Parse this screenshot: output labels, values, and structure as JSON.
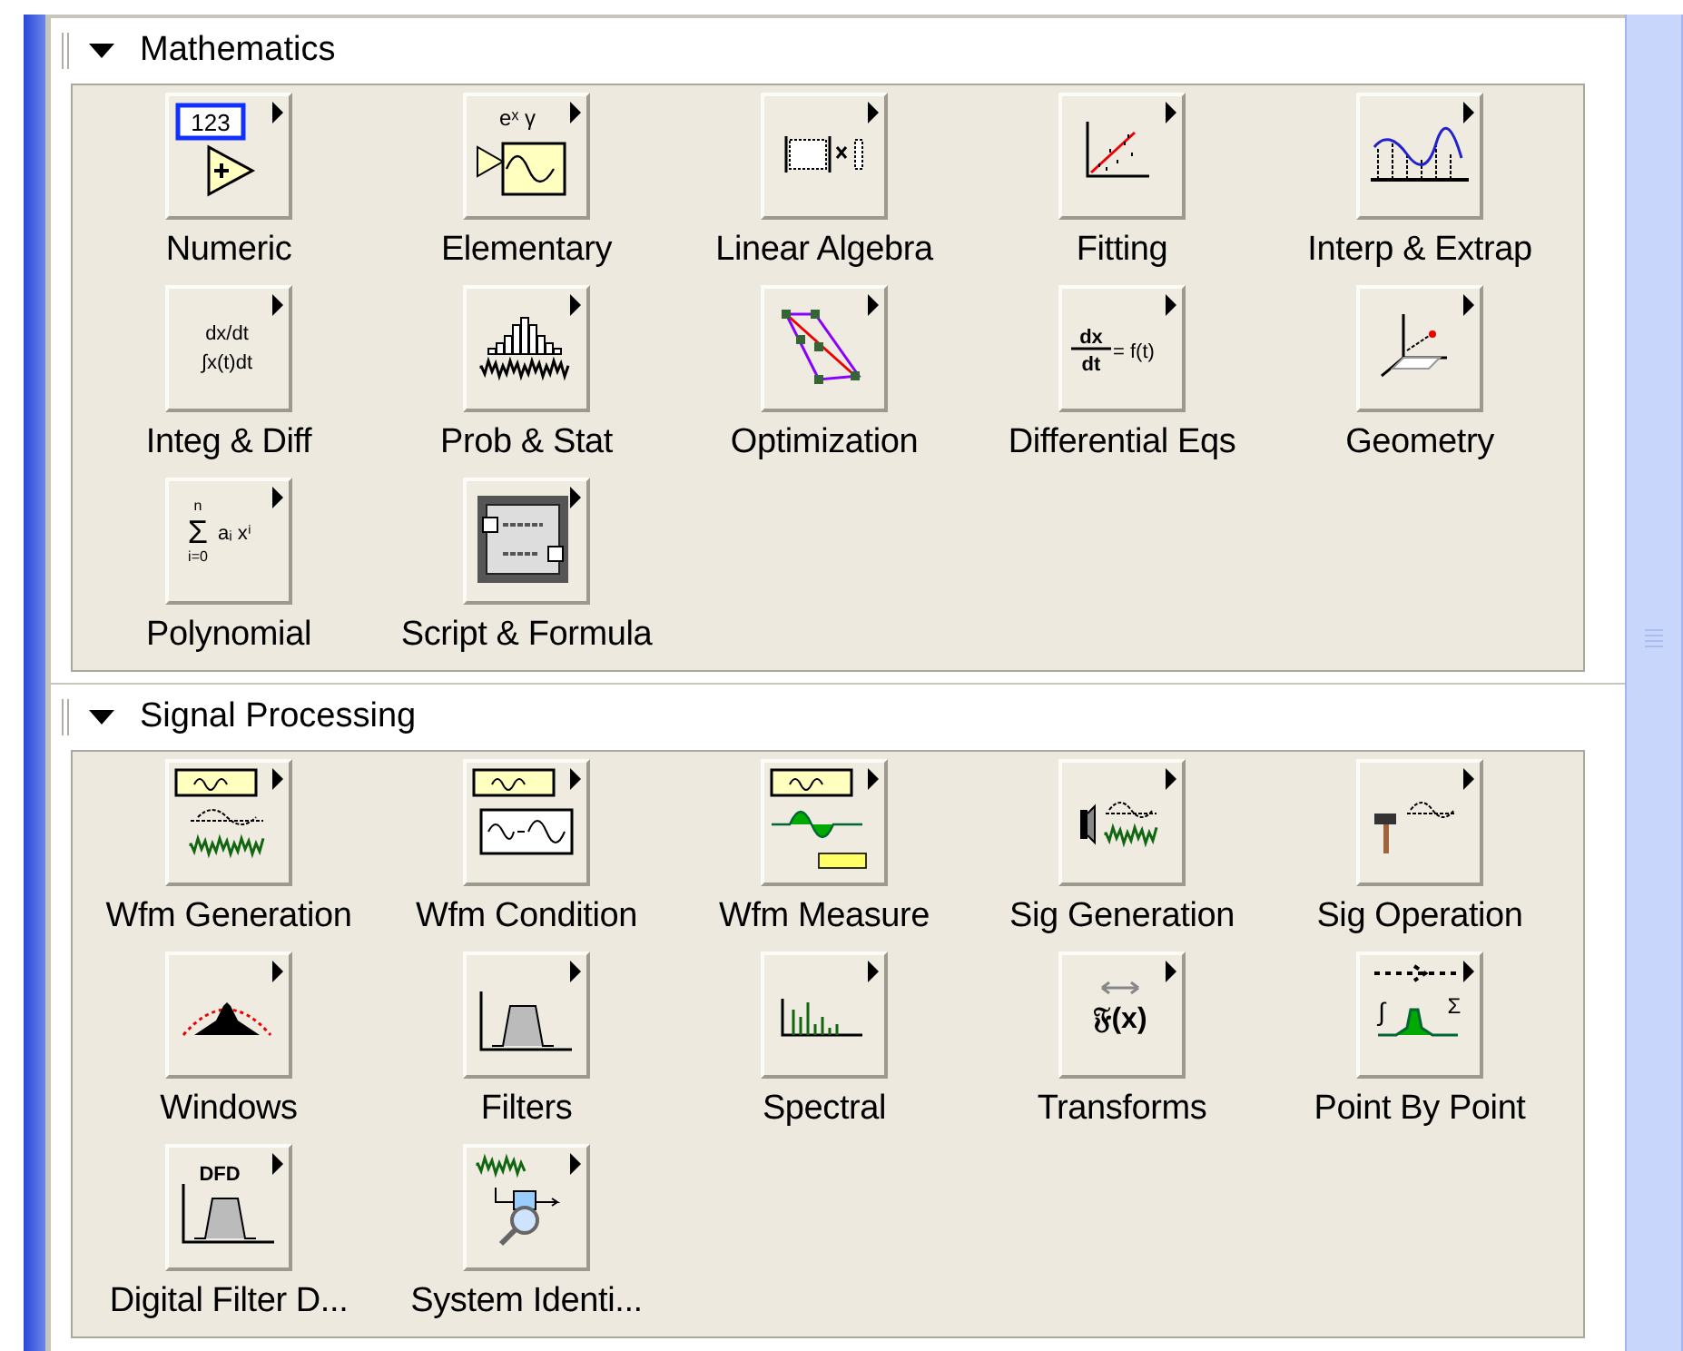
{
  "sections": [
    {
      "title": "Mathematics",
      "expanded": true,
      "items": [
        {
          "label": "Numeric",
          "kind": "numeric",
          "icon_text": [
            "123"
          ]
        },
        {
          "label": "Elementary",
          "kind": "elementary",
          "icon_text": [
            "eˣ γ"
          ]
        },
        {
          "label": "Linear Algebra",
          "kind": "matrix"
        },
        {
          "label": "Fitting",
          "kind": "fit"
        },
        {
          "label": "Interp & Extrap",
          "kind": "interp"
        },
        {
          "label": "Integ & Diff",
          "kind": "integ",
          "icon_text": [
            "dx/dt",
            "∫x(t)dt"
          ]
        },
        {
          "label": "Prob & Stat",
          "kind": "histogram"
        },
        {
          "label": "Optimization",
          "kind": "optimize"
        },
        {
          "label": "Differential Eqs",
          "kind": "diffeq",
          "icon_text": [
            "dx",
            "dt",
            "= f(t)"
          ]
        },
        {
          "label": "Geometry",
          "kind": "axes3d"
        },
        {
          "label": "Polynomial",
          "kind": "poly",
          "icon_text": [
            "n",
            "Σ",
            "i=0",
            "aᵢ xⁱ"
          ]
        },
        {
          "label": "Script & Formula",
          "kind": "script"
        }
      ]
    },
    {
      "title": "Signal Processing",
      "expanded": true,
      "items": [
        {
          "label": "Wfm Generation",
          "kind": "wfm_gen"
        },
        {
          "label": "Wfm Condition",
          "kind": "wfm_cond"
        },
        {
          "label": "Wfm Measure",
          "kind": "wfm_meas"
        },
        {
          "label": "Sig Generation",
          "kind": "sig_gen"
        },
        {
          "label": "Sig Operation",
          "kind": "sig_op"
        },
        {
          "label": "Windows",
          "kind": "window"
        },
        {
          "label": "Filters",
          "kind": "filter"
        },
        {
          "label": "Spectral",
          "kind": "spectral"
        },
        {
          "label": "Transforms",
          "kind": "transform",
          "icon_text": [
            "𝔉(x)"
          ]
        },
        {
          "label": "Point By Point",
          "kind": "pbp",
          "icon_text": [
            "∫",
            "Σ"
          ]
        },
        {
          "label": "Digital Filter D...",
          "kind": "dfd",
          "icon_text": [
            "DFD"
          ]
        },
        {
          "label": "System Identi...",
          "kind": "sysid"
        }
      ]
    }
  ]
}
